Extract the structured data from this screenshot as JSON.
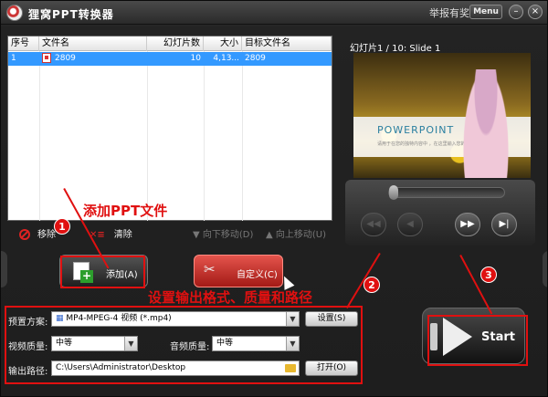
{
  "titlebar": {
    "title": "狸窝PPT转换器",
    "report": "举报有奖",
    "menu": "Menu",
    "min_glyph": "–",
    "close_glyph": "×"
  },
  "file_list": {
    "columns": [
      "序号",
      "文件名",
      "幻灯片数",
      "大小",
      "目标文件名"
    ],
    "rows": [
      {
        "index": "1",
        "filename": "2809",
        "slides": "10",
        "size": "4,13...",
        "target": "2809"
      }
    ]
  },
  "actions": {
    "remove": "移除",
    "clear": "清除",
    "move_down": "向下移动(D)",
    "move_up": "向上移动(U)"
  },
  "buttons": {
    "add": "添加(A)",
    "custom": "自定义(C)"
  },
  "preview": {
    "label": "幻灯片1 / 10: Slide 1",
    "slide_title": "POWERPOINT",
    "slide_subtitle": "请用于在您的独特内容中 ，在这里输入您的独特内容"
  },
  "player": {
    "prev_glyph": "◀◀",
    "rewind_glyph": "◀",
    "forward_glyph": "▶▶",
    "next_glyph": "▶|"
  },
  "settings": {
    "preset_label": "预置方案:",
    "preset_value": "MP4-MPEG-4 视频 (*.mp4)",
    "settings_button": "设置(S)",
    "video_quality_label": "视频质量:",
    "video_quality_value": "中等",
    "audio_quality_label": "音频质量:",
    "audio_quality_value": "中等",
    "output_label": "输出路径:",
    "output_value": "C:\\Users\\Administrator\\Desktop",
    "open_button": "打开(O)"
  },
  "start": {
    "label": "Start"
  },
  "annotations": {
    "step1_text": "添加PPT文件",
    "step2_text": "设置输出格式、质量和路径",
    "step1": "1",
    "step2": "2",
    "step3": "3",
    "color": "#e01010"
  }
}
